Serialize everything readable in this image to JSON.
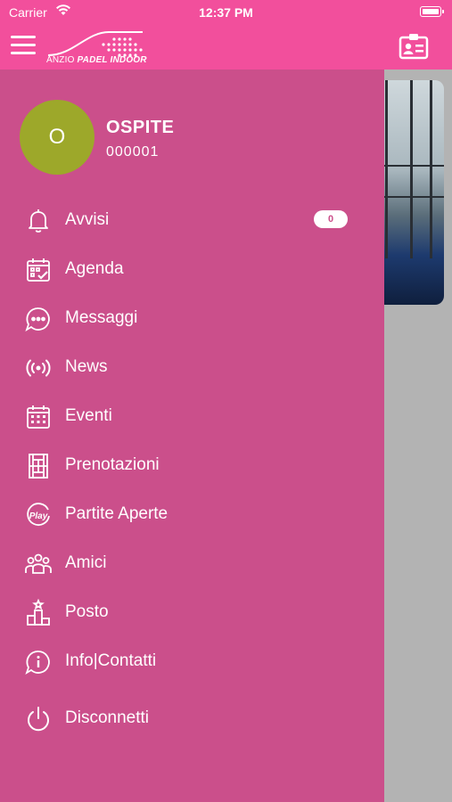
{
  "status_bar": {
    "carrier": "Carrier",
    "time": "12:37 PM"
  },
  "header": {
    "logo_text_light": "ANZIO ",
    "logo_text_bold": "PADEL INDOOR"
  },
  "user": {
    "initial": "O",
    "name": "OSPITE",
    "code": "000001"
  },
  "menu": [
    {
      "label": "Avvisi",
      "icon": "bell-icon",
      "badge": "0"
    },
    {
      "label": "Agenda",
      "icon": "calendar-check-icon"
    },
    {
      "label": "Messaggi",
      "icon": "chat-bubble-icon"
    },
    {
      "label": "News",
      "icon": "broadcast-icon"
    },
    {
      "label": "Eventi",
      "icon": "calendar-grid-icon"
    },
    {
      "label": "Prenotazioni",
      "icon": "court-icon"
    },
    {
      "label": "Partite Aperte",
      "icon": "play-badge-icon"
    },
    {
      "label": "Amici",
      "icon": "friends-icon"
    },
    {
      "label": "Posto",
      "icon": "podium-icon"
    },
    {
      "label": "Info|Contatti",
      "icon": "info-bubble-icon"
    },
    {
      "label": "Disconnetti",
      "icon": "power-icon"
    }
  ],
  "colors": {
    "header": "#f24f9c",
    "drawer": "#cb4f8b",
    "avatar": "#9da82a",
    "overlay": "#b3b3b3"
  }
}
